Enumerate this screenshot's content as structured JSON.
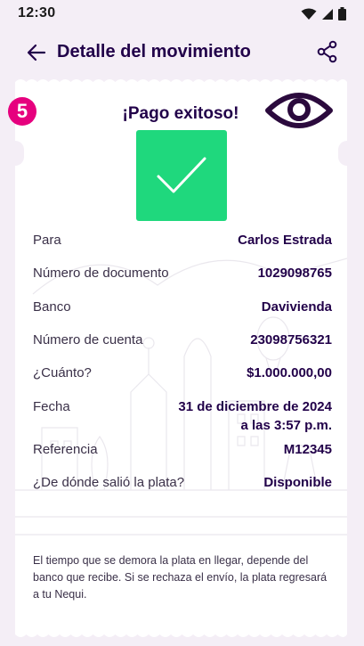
{
  "status": {
    "time": "12:30"
  },
  "header": {
    "title": "Detalle del movimiento"
  },
  "step_badge": "5",
  "receipt": {
    "title": "¡Pago exitoso!",
    "rows": [
      {
        "label": "Para",
        "value": "Carlos Estrada"
      },
      {
        "label": "Número de documento",
        "value": "1029098765"
      },
      {
        "label": "Banco",
        "value": "Davivienda"
      },
      {
        "label": "Número de cuenta",
        "value": "23098756321"
      },
      {
        "label": "¿Cuánto?",
        "value": "$1.000.000,00"
      },
      {
        "label": "Fecha",
        "value": "31 de diciembre de 2024",
        "value2": "a las 3:57 p.m."
      },
      {
        "label": "Referencia",
        "value": "M12345"
      },
      {
        "label": "¿De dónde salió la plata?",
        "value": "Disponible"
      }
    ],
    "footnote": "El tiempo que se demora la plata en llegar, depende del banco que recibe. Si se rechaza el envío, la plata regresará a tu Nequi."
  },
  "colors": {
    "brand": "#210049",
    "success": "#1fd87d",
    "badge": "#e6007e",
    "background": "#f4eef6"
  }
}
